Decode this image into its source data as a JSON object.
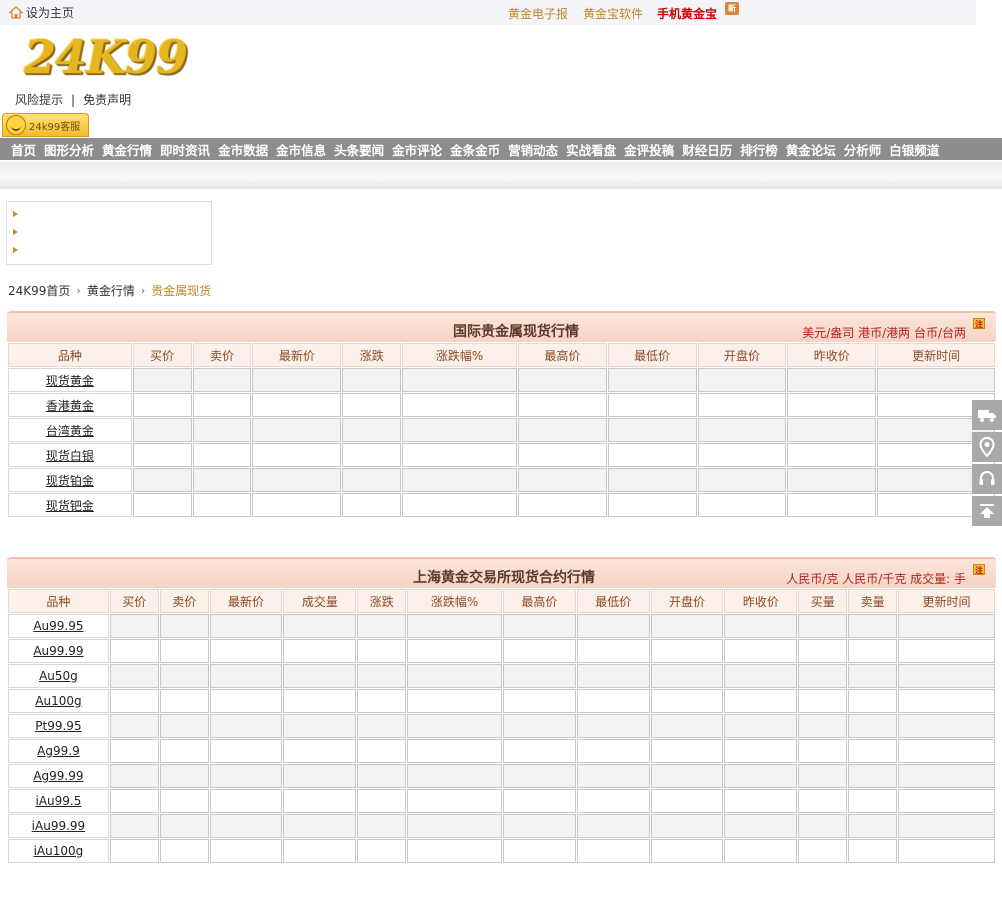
{
  "topbar": {
    "home": "设为主页",
    "links": [
      "黄金电子报",
      "黄金宝软件",
      "手机黄金宝"
    ],
    "new_badge": "新"
  },
  "logo": "24K99",
  "risk_links": [
    "风险提示",
    "免责声明"
  ],
  "service_button": "24k99客服",
  "nav": [
    "首页",
    "图形分析",
    "黄金行情",
    "即时资讯",
    "金市数据",
    "金市信息",
    "头条要闻",
    "金市评论",
    "金条金币",
    "营销动态",
    "实战看盘",
    "金评投稿",
    "财经日历",
    "排行榜",
    "黄金论坛",
    "分析师",
    "白银频道"
  ],
  "breadcrumb": [
    "24K99首页",
    "黄金行情",
    "贵金属现货"
  ],
  "intl_panel": {
    "title": "国际贵金属现货行情",
    "units": "美元/盎司 港币/港两 台币/台两",
    "note": "注",
    "columns": [
      "品种",
      "买价",
      "卖价",
      "最新价",
      "涨跌",
      "涨跌幅%",
      "最高价",
      "最低价",
      "开盘价",
      "昨收价",
      "更新时间"
    ],
    "rows": [
      "现货黄金",
      "香港黄金",
      "台湾黄金",
      "现货白银",
      "现货铂金",
      "现货钯金"
    ]
  },
  "sge_panel": {
    "title": "上海黄金交易所现货合约行情",
    "units": "人民币/克 人民币/千克 成交量: 手",
    "note": "注",
    "columns": [
      "品种",
      "买价",
      "卖价",
      "最新价",
      "成交量",
      "涨跌",
      "涨跌幅%",
      "最高价",
      "最低价",
      "开盘价",
      "昨收价",
      "买量",
      "卖量",
      "更新时间"
    ],
    "rows": [
      "Au99.95",
      "Au99.99",
      "Au50g",
      "Au100g",
      "Pt99.95",
      "Ag99.9",
      "Ag99.99",
      "iAu99.5",
      "iAu99.99",
      "iAu100g"
    ]
  },
  "side_widget": [
    "truck-icon",
    "location-icon",
    "headset-icon",
    "back-to-top-icon"
  ]
}
